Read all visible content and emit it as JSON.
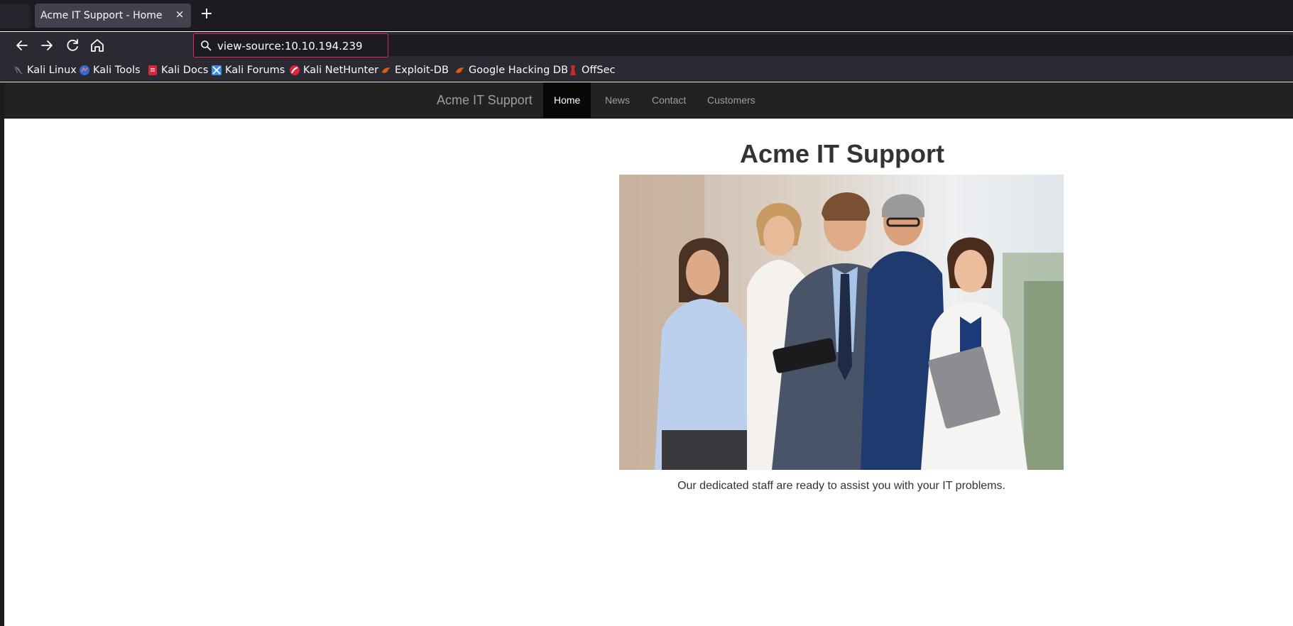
{
  "browser": {
    "tab": {
      "title": "Acme IT Support - Home",
      "close_glyph": "×"
    },
    "new_tab_glyph": "+",
    "url": "view-source:10.10.194.239",
    "nav_icons": [
      "back-arrow-icon",
      "forward-arrow-icon",
      "reload-icon",
      "home-icon"
    ],
    "bookmarks": [
      {
        "label": "Kali Linux",
        "icon": "kali-dragon-icon",
        "color": "#3b3b3b"
      },
      {
        "label": "Kali Tools",
        "icon": "kali-tools-icon",
        "color": "#2f6bd3"
      },
      {
        "label": "Kali Docs",
        "icon": "kali-docs-icon",
        "color": "#d7263d"
      },
      {
        "label": "Kali Forums",
        "icon": "kali-forums-icon",
        "color": "#3a8ee6"
      },
      {
        "label": "Kali NetHunter",
        "icon": "nethunter-icon",
        "color": "#d7263d"
      },
      {
        "label": "Exploit-DB",
        "icon": "exploit-db-icon",
        "color": "#e8590c"
      },
      {
        "label": "Google Hacking DB",
        "icon": "ghdb-icon",
        "color": "#e8590c"
      },
      {
        "label": "OffSec",
        "icon": "offsec-icon",
        "color": "#c92a2a"
      }
    ]
  },
  "site": {
    "brand": "Acme IT Support",
    "nav": [
      "Home",
      "News",
      "Contact",
      "Customers"
    ],
    "active_nav": "Home",
    "heading": "Acme IT Support",
    "caption": "Our dedicated staff are ready to assist you with your IT problems."
  },
  "colors": {
    "chrome_dark": "#1c1b22",
    "chrome_mid": "#2b2a33",
    "url_focus_border": "#e22850",
    "site_nav_bg": "#222222",
    "site_nav_active": "#080808"
  }
}
